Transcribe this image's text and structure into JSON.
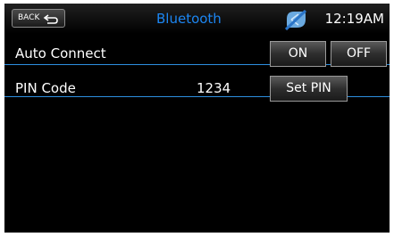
{
  "header": {
    "back_label": "BACK",
    "title": "Bluetooth",
    "clock": "12:19AM"
  },
  "auto_connect": {
    "label": "Auto Connect",
    "on_label": "ON",
    "off_label": "OFF"
  },
  "pin_code": {
    "label": "PIN Code",
    "value": "1234",
    "set_label": "Set PIN"
  },
  "colors": {
    "title_blue": "#1c86f2",
    "divider_blue": "#2d8fe0",
    "background": "#000000"
  },
  "icons": {
    "back": "return-arrow-icon",
    "status": "bluetooth-disconnected-icon"
  }
}
